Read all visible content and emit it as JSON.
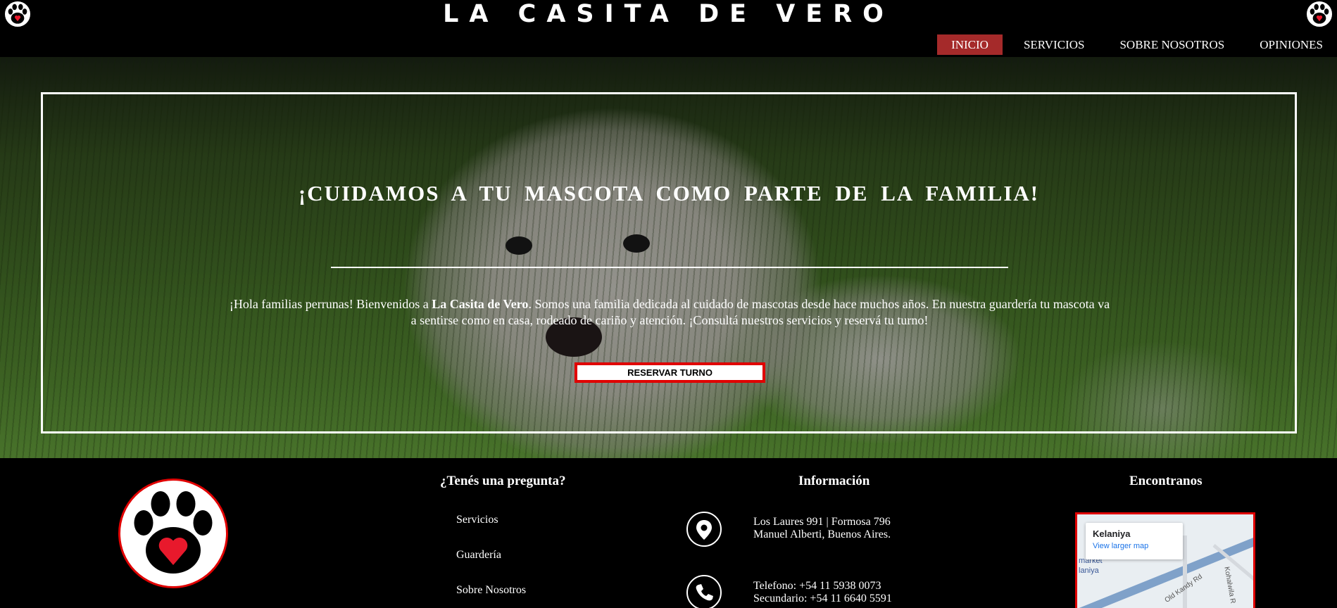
{
  "header": {
    "site_title": "LA CASITA DE VERO",
    "nav": [
      {
        "label": "INICIO",
        "active": true
      },
      {
        "label": "SERVICIOS",
        "active": false
      },
      {
        "label": "SOBRE NOSOTROS",
        "active": false
      },
      {
        "label": "OPINIONES",
        "active": false
      }
    ]
  },
  "hero": {
    "title": "¡CUIDAMOS A TU MASCOTA COMO PARTE DE LA FAMILIA!",
    "intro_before": "¡Hola familias perrunas! Bienvenidos a ",
    "intro_bold": "La Casita de Vero",
    "intro_after": ". Somos una familia dedicada al cuidado de mascotas desde hace muchos años. En nuestra guardería tu mascota va a sentirse como en casa, rodeado de cariño y atención. ¡Consultá nuestros servicios y reservá tu turno!",
    "button_label": "RESERVAR TURNO"
  },
  "footer": {
    "faq": {
      "title": "¿Tenés una pregunta?",
      "links": [
        "Servicios",
        "Guardería",
        "Sobre Nosotros"
      ]
    },
    "info": {
      "title": "Información",
      "address_line1": "Los Laures 991 | Formosa 796",
      "address_line2": "Manuel Alberti, Buenos Aires.",
      "phone_line1": "Telefono: +54 11 5938 0073",
      "phone_line2": "Secundario: +54 11 6640 5591"
    },
    "find_us": {
      "title": "Encontranos",
      "map_place": "Kelaniya",
      "map_link": "View larger map",
      "map_label_1": "market",
      "map_label_2": "laniya",
      "map_road_1": "Old Kandy Rd",
      "map_road_2": "Kohalwila R"
    }
  },
  "colors": {
    "header_bg": "#000000",
    "nav_active": "#a52a2a",
    "button_border": "#e00000",
    "paw": "#000000",
    "heart": "#e8192c"
  },
  "icons": [
    "paw-logo-icon",
    "location-pin-icon",
    "phone-icon"
  ]
}
